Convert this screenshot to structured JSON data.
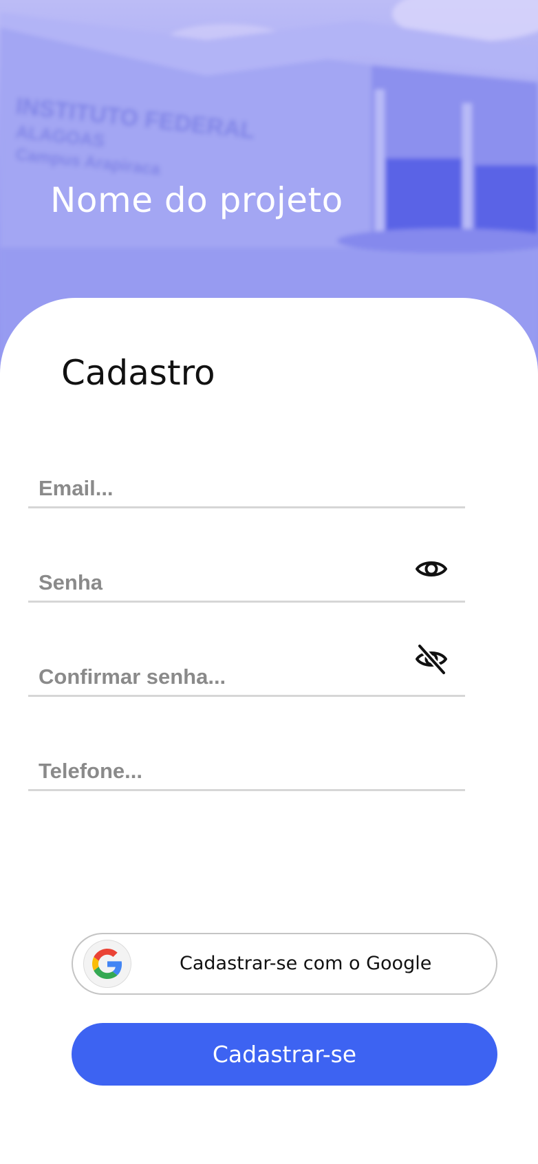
{
  "header": {
    "project_name": "Nome do projeto"
  },
  "form": {
    "title": "Cadastro",
    "email_placeholder": "Email...",
    "password_placeholder": "Senha",
    "confirm_password_placeholder": "Confirmar senha...",
    "phone_placeholder": "Telefone...",
    "password_icon": "eye-icon",
    "confirm_password_icon": "eye-off-icon"
  },
  "buttons": {
    "google_label": "Cadastrar-se com o Google",
    "google_icon": "google-logo-icon",
    "submit_label": "Cadastrar-se"
  },
  "colors": {
    "primary": "#3d63f2",
    "hero_tint": "#9a9df2",
    "field_underline": "#d6d6d6",
    "placeholder": "#8a8a8a"
  }
}
